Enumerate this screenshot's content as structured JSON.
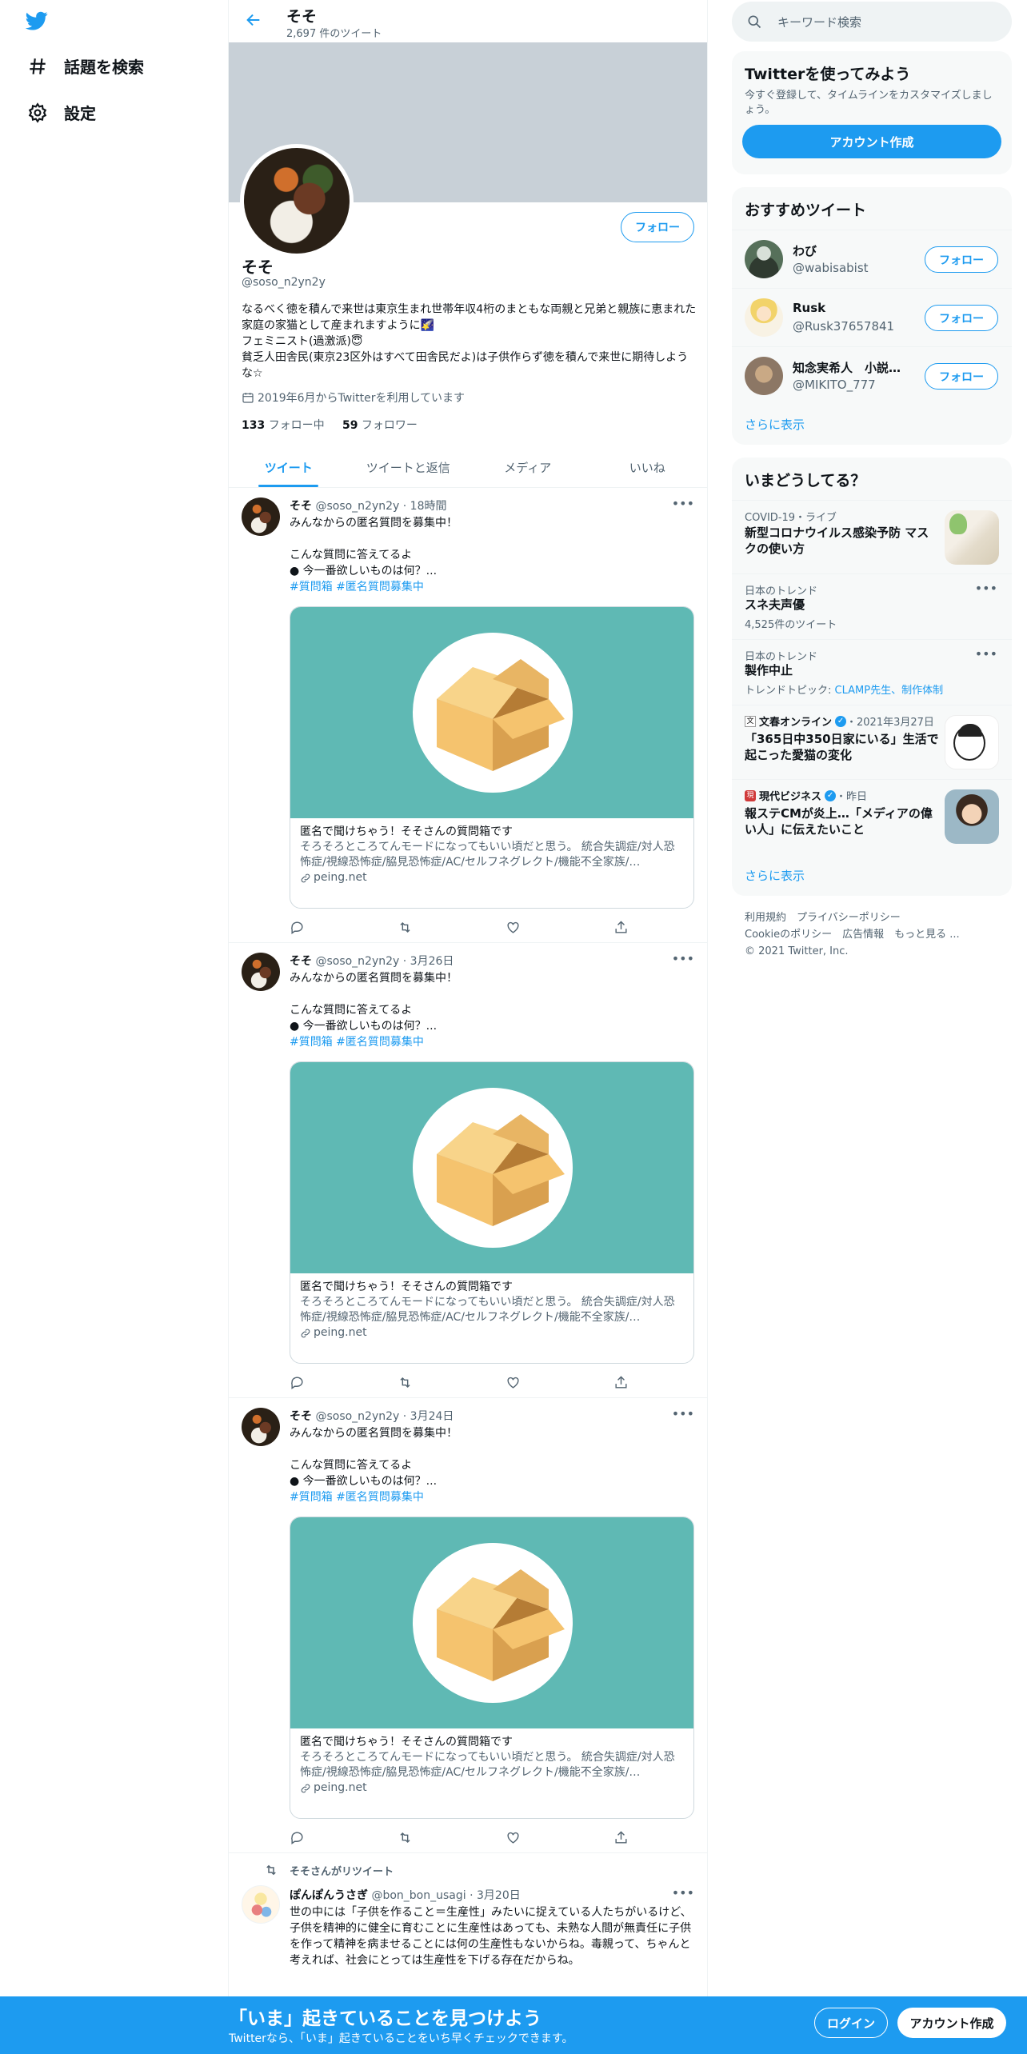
{
  "nav": {
    "explore_label": "話題を検索",
    "settings_label": "設定"
  },
  "profile": {
    "name": "そそ",
    "tweet_count": "2,697 件のツイート",
    "handle": "@soso_n2yn2y",
    "follow_label": "フォロー",
    "bio_lines": [
      "なるべく徳を積んで来世は東京生まれ世帯年収4桁のまともな両親と兄弟と親族に恵まれた家庭の家猫として産まれますように🌠",
      "フェミニスト(過激派)😇",
      "貧乏人田舎民(東京23区外はすべて田舎民だよ)は子供作らず徳を積んで来世に期待しような☆"
    ],
    "joined": "2019年6月からTwitterを利用しています",
    "following_count": "133",
    "following_label": "フォロー中",
    "followers_count": "59",
    "followers_label": "フォロワー"
  },
  "tabs": [
    "ツイート",
    "ツイートと返信",
    "メディア",
    "いいね"
  ],
  "tweets": [
    {
      "name": "そそ",
      "handle": "@soso_n2yn2y",
      "time": "18時間",
      "line1": "みんなからの匿名質問を募集中！",
      "line2": "こんな質問に答えてるよ",
      "line3": "● 今一番欲しいものは何？...",
      "hashtags": "#質問箱 #匿名質問募集中",
      "card_title": "匿名で聞けちゃう！そそさんの質問箱です",
      "card_desc": "そろそろところてんモードになってもいい頃だと思う。 統合失調症/対人恐怖症/視線恐怖症/脇見恐怖症/AC/セルフネグレクト/機能不全家族/…",
      "card_domain": "peing.net"
    },
    {
      "name": "そそ",
      "handle": "@soso_n2yn2y",
      "time": "3月26日",
      "line1": "みんなからの匿名質問を募集中！",
      "line2": "こんな質問に答えてるよ",
      "line3": "● 今一番欲しいものは何？...",
      "hashtags": "#質問箱 #匿名質問募集中",
      "card_title": "匿名で聞けちゃう！そそさんの質問箱です",
      "card_desc": "そろそろところてんモードになってもいい頃だと思う。 統合失調症/対人恐怖症/視線恐怖症/脇見恐怖症/AC/セルフネグレクト/機能不全家族/…",
      "card_domain": "peing.net"
    },
    {
      "name": "そそ",
      "handle": "@soso_n2yn2y",
      "time": "3月24日",
      "line1": "みんなからの匿名質問を募集中！",
      "line2": "こんな質問に答えてるよ",
      "line3": "● 今一番欲しいものは何？...",
      "hashtags": "#質問箱 #匿名質問募集中",
      "card_title": "匿名で聞けちゃう！そそさんの質問箱です",
      "card_desc": "そろそろところてんモードになってもいい頃だと思う。 統合失調症/対人恐怖症/視線恐怖症/脇見恐怖症/AC/セルフネグレクト/機能不全家族/…",
      "card_domain": "peing.net"
    }
  ],
  "retweet": {
    "label": "そそさんがリツイート",
    "name": "ぽんぽんうさぎ",
    "handle": "@bon_bon_usagi",
    "time": "3月20日",
    "text": "世の中には「子供を作ること＝生産性」みたいに捉えている人たちがいるけど、子供を精神的に健全に育むことに生産性はあっても、未熟な人間が無責任に子供を作って精神を病ませることには何の生産性もないからね。毒親って、ちゃんと考えれば、社会にとっては生産性を下げる存在だからね。"
  },
  "sidebar": {
    "search_placeholder": "キーワード検索",
    "signup_title": "Twitterを使ってみよう",
    "signup_desc": "今すぐ登録して、タイムラインをカスタマイズしましょう。",
    "signup_button": "アカウント作成",
    "rec_title": "おすすめツイート",
    "recommendations": [
      {
        "name": "わび",
        "handle": "@wabisabist",
        "follow": "フォロー"
      },
      {
        "name": "Rusk",
        "handle": "@Rusk37657841",
        "follow": "フォロー"
      },
      {
        "name": "知念実希人　小説家...",
        "handle": "@MIKITO_777",
        "follow": "フォロー"
      }
    ],
    "show_more": "さらに表示",
    "trends_title": "いまどうしてる？",
    "trends": [
      {
        "meta": "COVID-19・ライブ",
        "title1": "新型コロナウイルス感染予防 マス",
        "title2": "クの使い方"
      },
      {
        "meta": "日本のトレンド",
        "title": "スネ夫声優",
        "sub": "4,525件のツイート"
      },
      {
        "meta": "日本のトレンド",
        "title": "製作中止",
        "sub_prefix": "トレンドトピック: ",
        "sub_link": "CLAMP先生、制作体制"
      },
      {
        "source": "文春オンライン",
        "time": "・2021年3月27日",
        "title1": "「365日中350日家にいる」生活で",
        "title2": "起こった愛猫の変化"
      },
      {
        "source": "現代ビジネス",
        "time": "・昨日",
        "title1": "報ステCMが炎上…「メディアの偉",
        "title2": "い人」に伝えたいこと"
      }
    ],
    "trends_more": "さらに表示",
    "footer_line1": "利用規約　プライバシーポリシー",
    "footer_line2": "Cookieのポリシー　広告情報　もっと見る ...",
    "footer_line3": "© 2021 Twitter, Inc."
  },
  "bottom_bar": {
    "title": "「いま」起きていることを見つけよう",
    "subtitle": "Twitterなら、「いま」起きていることをいち早くチェックできます。",
    "login": "ログイン",
    "signup": "アカウント作成"
  },
  "colors": {
    "accent": "#1d9bf0",
    "banner": "#c8d0d7",
    "card_bg": "#5fb9b4"
  }
}
